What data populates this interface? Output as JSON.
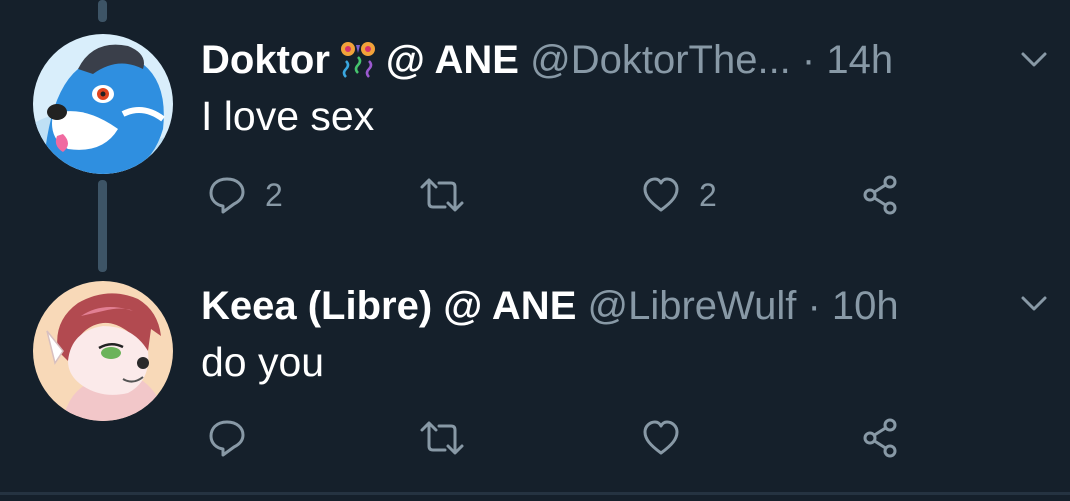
{
  "tweets": [
    {
      "name": "Doktor",
      "emoji": "party-emoji",
      "name_suffix": "@ ANE",
      "handle": "@DoktorThe...",
      "separator": "·",
      "time": "14h",
      "text": "I love sex",
      "replies": "2",
      "retweets": "",
      "likes": "2"
    },
    {
      "name": "Keea (Libre) @ ANE",
      "handle": "@LibreWulf",
      "separator": "·",
      "time": "10h",
      "text": "do you",
      "replies": "",
      "retweets": "",
      "likes": ""
    }
  ],
  "colors": {
    "background": "#15202b",
    "primary_text": "#ffffff",
    "secondary_text": "#8899a6",
    "thread_line": "#3d5466"
  },
  "icons": {
    "reply": "reply-icon",
    "retweet": "retweet-icon",
    "like": "heart-icon",
    "share": "share-icon",
    "more": "chevron-down-icon"
  }
}
